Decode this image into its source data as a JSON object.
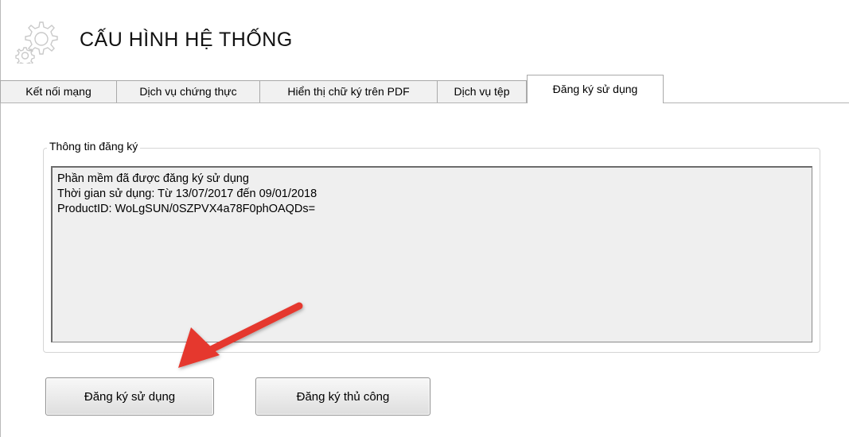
{
  "header": {
    "title": "CẤU HÌNH HỆ THỐNG",
    "icon": "gear-icon"
  },
  "tabs": [
    {
      "label": "Kết nối mạng",
      "active": false
    },
    {
      "label": "Dịch vụ chứng thực",
      "active": false
    },
    {
      "label": "Hiển thị chữ ký trên PDF",
      "active": false
    },
    {
      "label": "Dịch vụ tệp",
      "active": false
    },
    {
      "label": "Đăng ký sử dụng",
      "active": true
    }
  ],
  "registration": {
    "group_label": "Thông tin đăng ký",
    "lines": [
      "Phần mềm đã được đăng ký sử dụng",
      "Thời gian sử dụng: Từ 13/07/2017 đến 09/01/2018",
      "ProductID: WoLgSUN/0SZPVX4a78F0phOAQDs="
    ]
  },
  "buttons": {
    "register": "Đăng ký sử dụng",
    "manual_register": "Đăng ký thủ công"
  },
  "colors": {
    "arrow": "#e5392f"
  }
}
